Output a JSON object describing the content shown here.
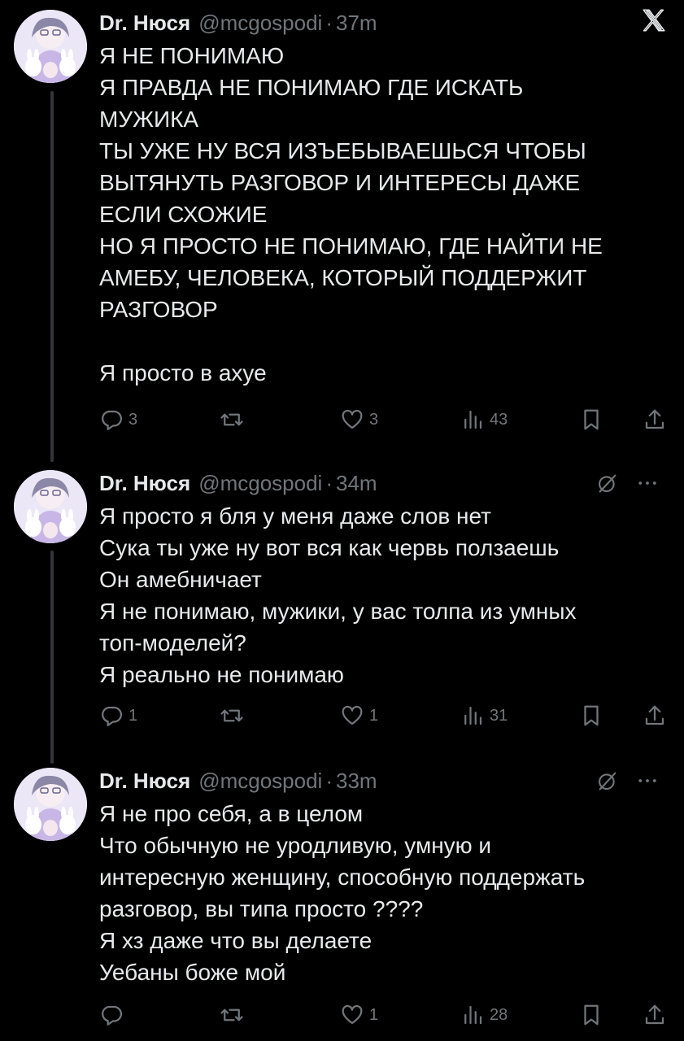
{
  "brand_icon": "x-logo-icon",
  "tweets": [
    {
      "name": "Dr. Нюся",
      "handle": "@mcgospodi",
      "separator": "·",
      "time": "37m",
      "text": "Я НЕ ПОНИМАЮ\nЯ ПРАВДА НЕ ПОНИМАЮ ГДЕ ИСКАТЬ\nМУЖИКА\nТЫ УЖЕ НУ ВСЯ ИЗЪЕБЫВАЕШЬСЯ ЧТОБЫ\nВЫТЯНУТЬ РАЗГОВОР И ИНТЕРЕСЫ ДАЖЕ\nЕСЛИ СХОЖИЕ\nНО Я ПРОСТО НЕ ПОНИМАЮ, ГДЕ НАЙТИ НЕ\nАМЕБУ, ЧЕЛОВЕКА, КОТОРЫЙ ПОДДЕРЖИТ\nРАЗГОВОР\n\nЯ просто в ахуе",
      "replies": "3",
      "retweets": "",
      "likes": "3",
      "views": "43"
    },
    {
      "name": "Dr. Нюся",
      "handle": "@mcgospodi",
      "separator": "·",
      "time": "34m",
      "text": "Я просто я бля у меня даже слов нет\nСука ты уже ну вот вся как червь ползаешь\nОн амебничает\nЯ не понимаю, мужики, у вас толпа из умных\nтоп-моделей?\nЯ реально не понимаю",
      "replies": "1",
      "retweets": "",
      "likes": "1",
      "views": "31"
    },
    {
      "name": "Dr. Нюся",
      "handle": "@mcgospodi",
      "separator": "·",
      "time": "33m",
      "text": "Я не про себя, а в целом\nЧто обычную не уродливую, умную и\nинтересную женщину, способную поддержать\nразговор, вы типа просто ????\nЯ хз даже что вы делаете\nУебаны боже мой",
      "replies": "",
      "retweets": "",
      "likes": "1",
      "views": "28"
    }
  ],
  "colors": {
    "background": "#000000",
    "text_primary": "#e7e9ea",
    "text_secondary": "#71767b",
    "thread_line": "#333639"
  }
}
